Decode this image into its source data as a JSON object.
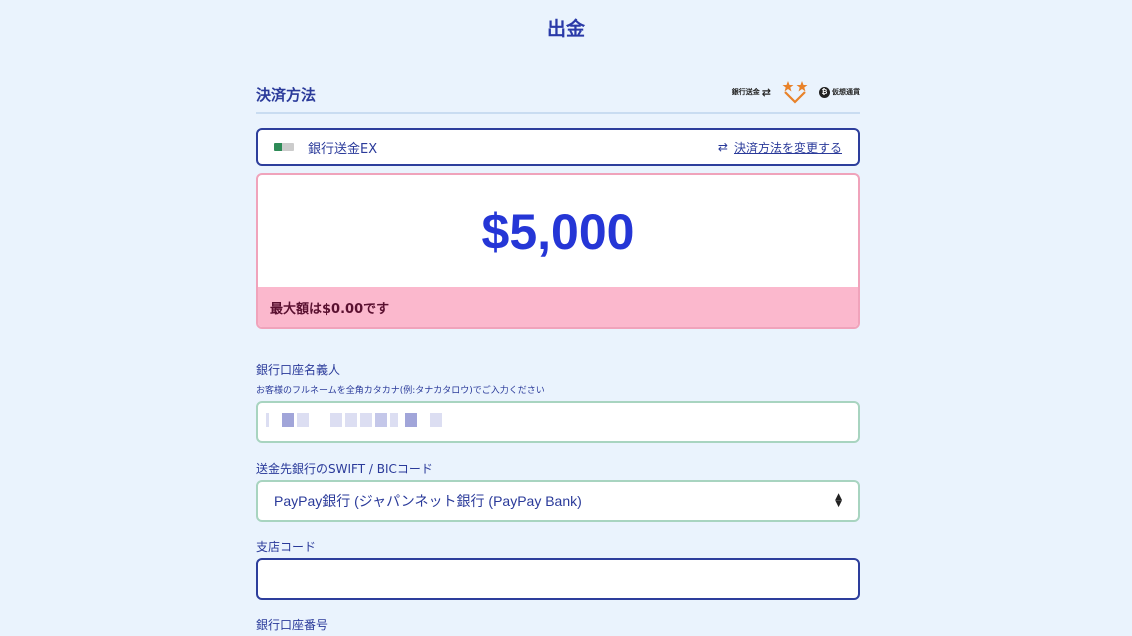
{
  "page": {
    "title": "出金"
  },
  "payment_section": {
    "title": "決済方法",
    "icons": {
      "bank_label": "銀行送金",
      "crypto_label": "仮想通貨",
      "bank_icon": "bank-transfer-icon",
      "star_icon": "star-rank-icon",
      "crypto_icon": "bitcoin-icon"
    }
  },
  "method": {
    "name": "銀行送金EX",
    "change_label": "決済方法を変更する"
  },
  "amount": {
    "value": "$5,000",
    "error": "最大額は$0.00です",
    "value_color": "#2536d6",
    "error_bg": "#fbb8cd"
  },
  "form": {
    "account_name": {
      "label": "銀行口座名義人",
      "hint": "お客様のフルネームを全角カタカナ(例:タナカタロウ)でご入力ください"
    },
    "swift": {
      "label": "送金先銀行のSWIFT / BICコード",
      "value": "PayPay銀行 (ジャパンネット銀行 (PayPay Bank)"
    },
    "branch": {
      "label": "支店コード"
    },
    "account_number": {
      "label": "銀行口座番号"
    }
  },
  "colors": {
    "accent": "#2d3e9c",
    "background": "#eaf3fd",
    "field_border_valid": "#a8d4c0",
    "error_border": "#f0a3bb"
  }
}
